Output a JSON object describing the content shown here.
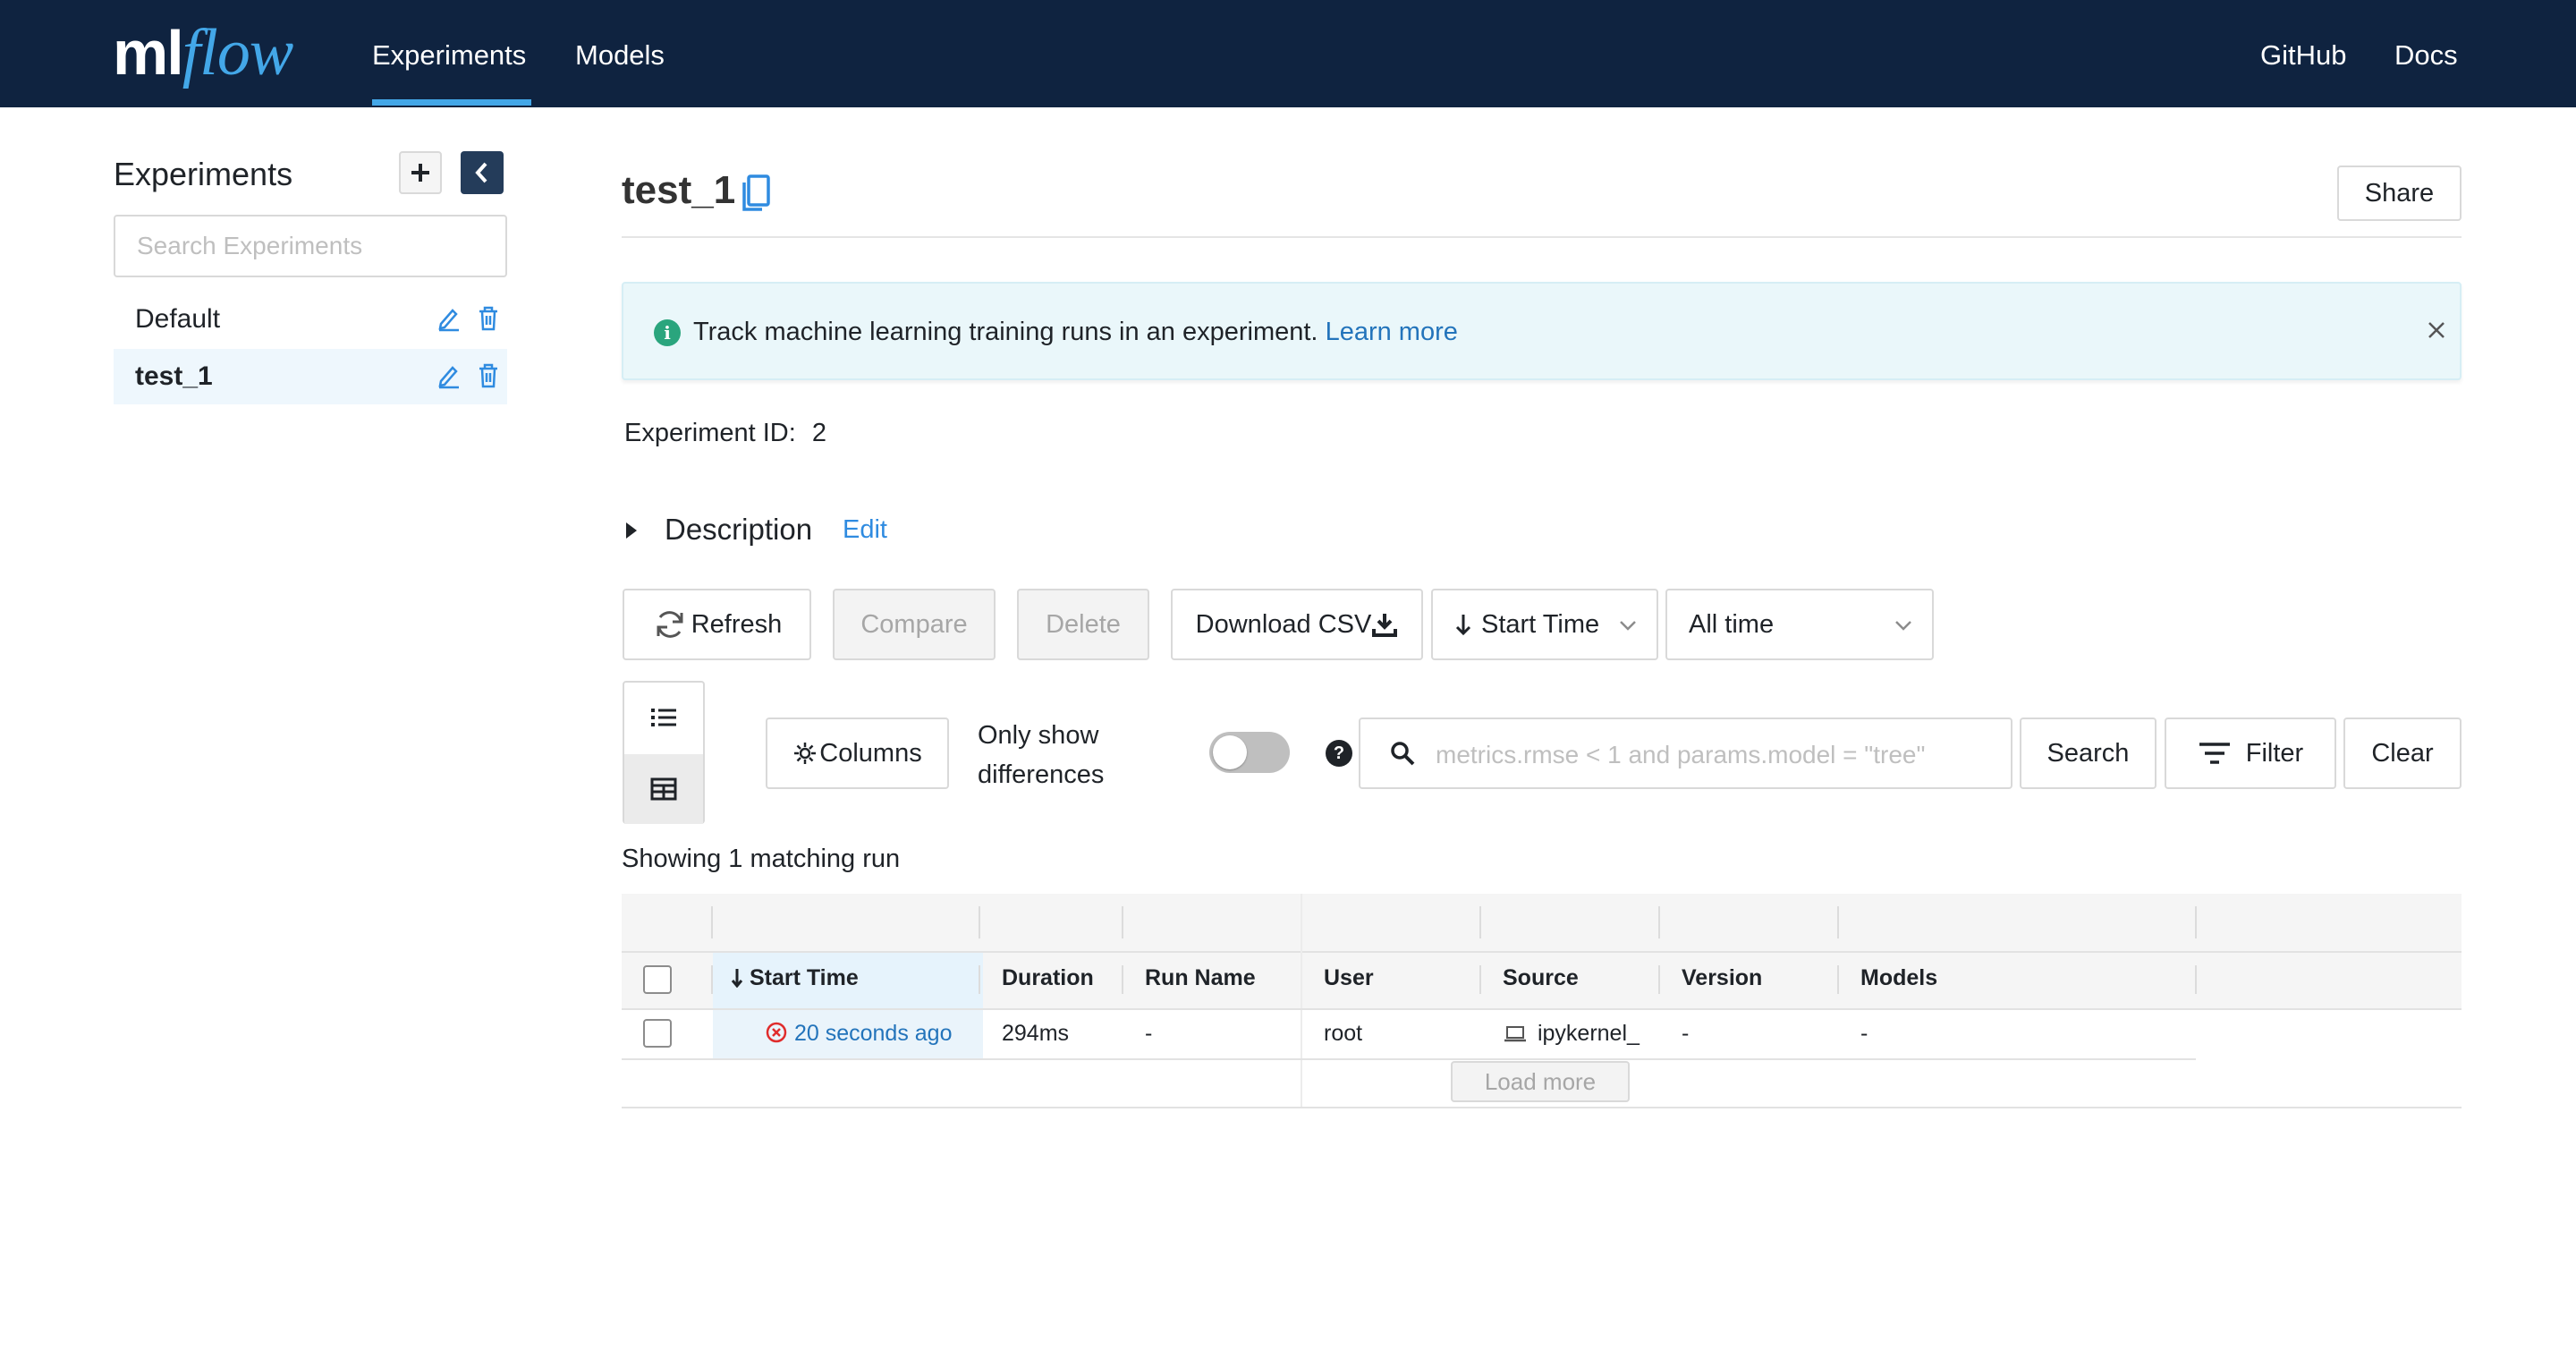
{
  "header": {
    "logo_ml": "ml",
    "logo_flow": "flow",
    "nav": [
      {
        "label": "Experiments",
        "active": true
      },
      {
        "label": "Models",
        "active": false
      }
    ],
    "right_links": [
      {
        "label": "GitHub"
      },
      {
        "label": "Docs"
      }
    ]
  },
  "sidebar": {
    "title": "Experiments",
    "add_icon": "plus-icon",
    "collapse_icon": "chevron-left-icon",
    "search_placeholder": "Search Experiments",
    "items": [
      {
        "label": "Default",
        "active": false
      },
      {
        "label": "test_1",
        "active": true
      }
    ]
  },
  "main": {
    "title": "test_1",
    "copy_icon": "copy-icon",
    "share_label": "Share",
    "banner": {
      "text": "Track machine learning training runs in an experiment.",
      "link": "Learn more",
      "close_icon": "close-icon"
    },
    "experiment_id_label": "Experiment ID:",
    "experiment_id": "2",
    "description_label": "Description",
    "description_edit": "Edit",
    "toolbar": {
      "refresh": "Refresh",
      "compare": "Compare",
      "delete": "Delete",
      "download_csv": "Download CSV",
      "sort_select": "Start Time",
      "time_select": "All time"
    },
    "filters": {
      "columns": "Columns",
      "only_show_line1": "Only show",
      "only_show_line2": "differences",
      "toggle_on": false,
      "search_placeholder": "metrics.rmse < 1 and params.model = \"tree\"",
      "search": "Search",
      "filter": "Filter",
      "clear": "Clear"
    },
    "showing": "Showing 1 matching run",
    "table": {
      "columns": [
        "Start Time",
        "Duration",
        "Run Name",
        "User",
        "Source",
        "Version",
        "Models"
      ],
      "rows": [
        {
          "start_time": "20 seconds ago",
          "status": "failed",
          "duration": "294ms",
          "run_name": "-",
          "user": "root",
          "source": "ipykernel_",
          "version": "-",
          "models": "-"
        }
      ],
      "load_more": "Load more"
    },
    "colors": {
      "header_bg": "#0f2340",
      "accent": "#43a7e8",
      "link": "#2374bb",
      "error": "#e02c2c"
    }
  }
}
